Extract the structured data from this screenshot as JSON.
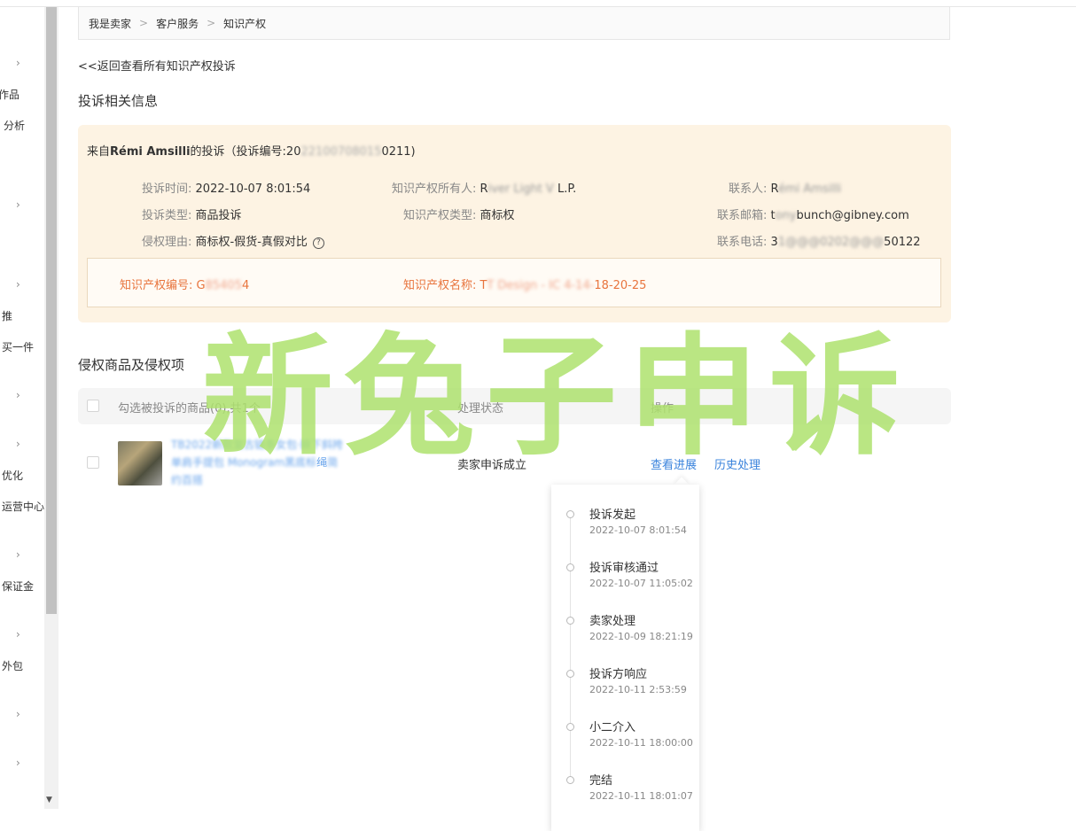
{
  "sidebar": {
    "items": [
      "作品",
      "分析",
      "推",
      "买一件",
      "优化",
      "运营中心",
      "保证金",
      "外包"
    ]
  },
  "breadcrumb": {
    "items": [
      "我是卖家",
      "客户服务",
      "知识产权"
    ],
    "separator": ">"
  },
  "back_link": "<<返回查看所有知识产权投诉",
  "info_section": {
    "title": "投诉相关信息",
    "complaint_prefix": "来自",
    "complainant": "Rémi Amsilli",
    "complaint_suffix": "的投诉（投诉编号:20",
    "complaint_id_blurred": "22100708015",
    "complaint_id_end": "0211)",
    "fields": {
      "time_label": "投诉时间:",
      "time_value": "2022-10-07 8:01:54",
      "owner_label": "知识产权所有人:",
      "owner_value_start": "R",
      "owner_value_blurred": "iver Light V",
      "owner_value_end": "L.P.",
      "contact_label": "联系人:",
      "contact_value_start": "R",
      "contact_value_blurred": "émi Amsilli",
      "type_label": "投诉类型:",
      "type_value": "商品投诉",
      "ip_type_label": "知识产权类型:",
      "ip_type_value": "商标权",
      "email_label": "联系邮箱:",
      "email_value_start": "t",
      "email_value_blurred": "ony",
      "email_value_end": "bunch@gibney.com",
      "reason_label": "侵权理由:",
      "reason_value": "商标权-假货-真假对比",
      "phone_label": "联系电话:",
      "phone_value_start": "3",
      "phone_value_blurred": "1@@@0202@@@",
      "phone_value_end": "50122"
    },
    "ip_number_label": "知识产权编号:",
    "ip_number_start": "G",
    "ip_number_blurred": "85405",
    "ip_number_end": "4",
    "ip_name_label": "知识产权名称:",
    "ip_name_start": "T",
    "ip_name_blurred": "T Design - IC 4-14-",
    "ip_name_end": "18-20-25"
  },
  "products_section": {
    "title": "侵权商品及侵权项",
    "headers": {
      "select": "勾选被投诉的商品(0),共1个",
      "status": "处理状态",
      "action": "操作"
    },
    "row": {
      "title_blurred": "TB2022新款复古链条女包·腋下斜挎单肩手提包 Monogram黑底标",
      "title_visible": "绳",
      "title_blurred_end": "简约百搭",
      "status": "卖家申诉成立",
      "action_progress": "查看进展",
      "action_history": "历史处理"
    }
  },
  "progress": {
    "steps": [
      {
        "title": "投诉发起",
        "time": "2022-10-07 8:01:54"
      },
      {
        "title": "投诉审核通过",
        "time": "2022-10-07 11:05:02"
      },
      {
        "title": "卖家处理",
        "time": "2022-10-09 18:21:19"
      },
      {
        "title": "投诉方响应",
        "time": "2022-10-11 2:53:59"
      },
      {
        "title": "小二介入",
        "time": "2022-10-11 18:00:00"
      },
      {
        "title": "完结",
        "time": "2022-10-11 18:01:07"
      }
    ]
  },
  "watermark": "新兔子申诉",
  "colors": {
    "card_bg": "#fdf3e3",
    "ip_text": "#e8743d",
    "link": "#3a83dc",
    "watermark": "#aee26e"
  }
}
